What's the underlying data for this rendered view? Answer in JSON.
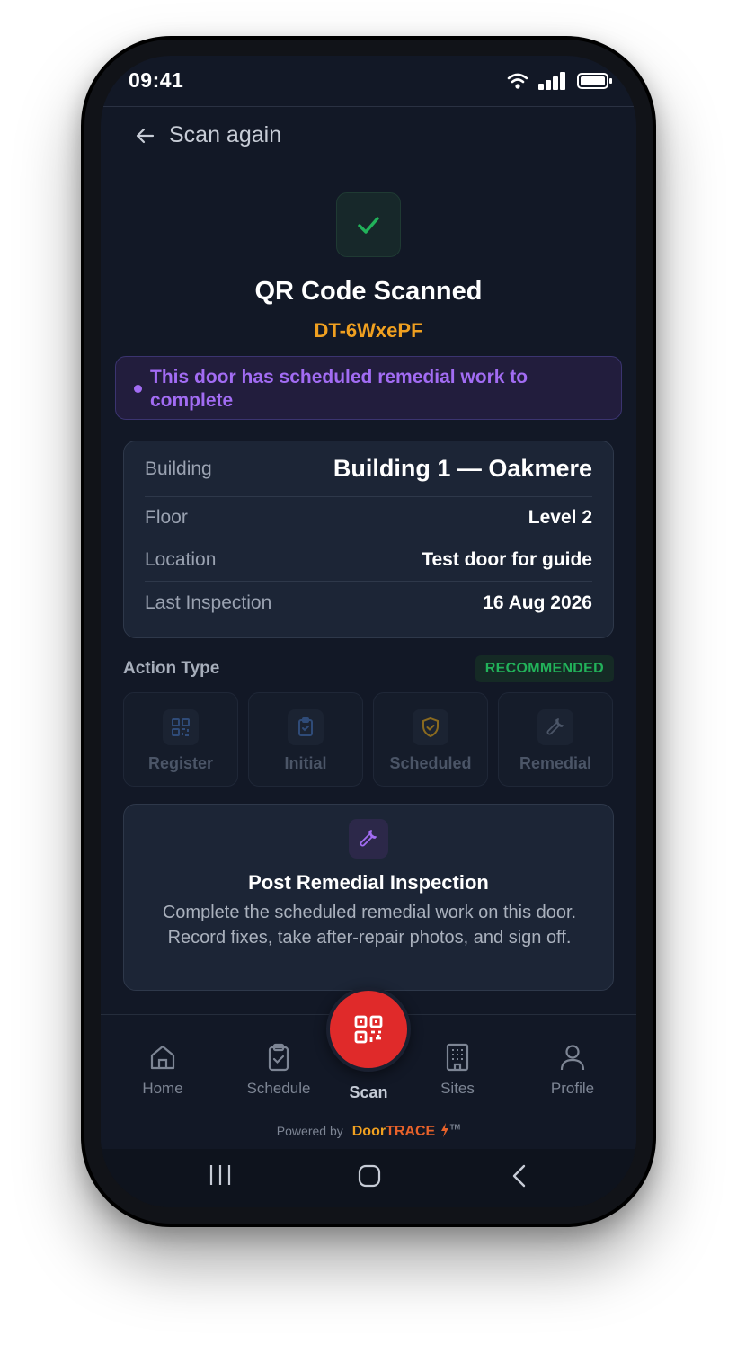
{
  "status": {
    "time": "09:41"
  },
  "header": {
    "back_label": "Scan again"
  },
  "scan": {
    "title": "QR Code Scanned",
    "code": "DT-6WxePF"
  },
  "notice": {
    "text": "This door has scheduled remedial work to complete"
  },
  "details": {
    "rows": [
      {
        "label": "Building",
        "value": "Building 1 — Oakmere"
      },
      {
        "label": "Floor",
        "value": "Level 2"
      },
      {
        "label": "Location",
        "value": "Test door for guide"
      },
      {
        "label": "Last Inspection",
        "value": "16 Aug 2026"
      }
    ]
  },
  "actions": {
    "title": "Action Type",
    "badge": "RECOMMENDED",
    "items": [
      {
        "label": "Register",
        "icon": "qr-icon"
      },
      {
        "label": "Initial",
        "icon": "clipboard-icon"
      },
      {
        "label": "Scheduled",
        "icon": "shield-icon"
      },
      {
        "label": "Remedial",
        "icon": "wrench-icon"
      }
    ]
  },
  "selected_action": {
    "title": "Post Remedial Inspection",
    "description": "Complete the scheduled remedial work on this door. Record fixes, take after-repair photos, and sign off."
  },
  "nav": {
    "items": [
      {
        "label": "Home",
        "icon": "home-icon"
      },
      {
        "label": "Schedule",
        "icon": "clipboard-icon"
      },
      {
        "label": "Scan",
        "icon": "qr-icon"
      },
      {
        "label": "Sites",
        "icon": "building-icon"
      },
      {
        "label": "Profile",
        "icon": "user-icon"
      }
    ]
  },
  "footer": {
    "powered_by": "Powered by",
    "brand_a": "Door",
    "brand_b": "TRACE",
    "tm": "TM"
  },
  "colors": {
    "accent": "#e02a2a",
    "code": "#f0a020",
    "notice": "#a26cf3",
    "success": "#22b25a"
  }
}
